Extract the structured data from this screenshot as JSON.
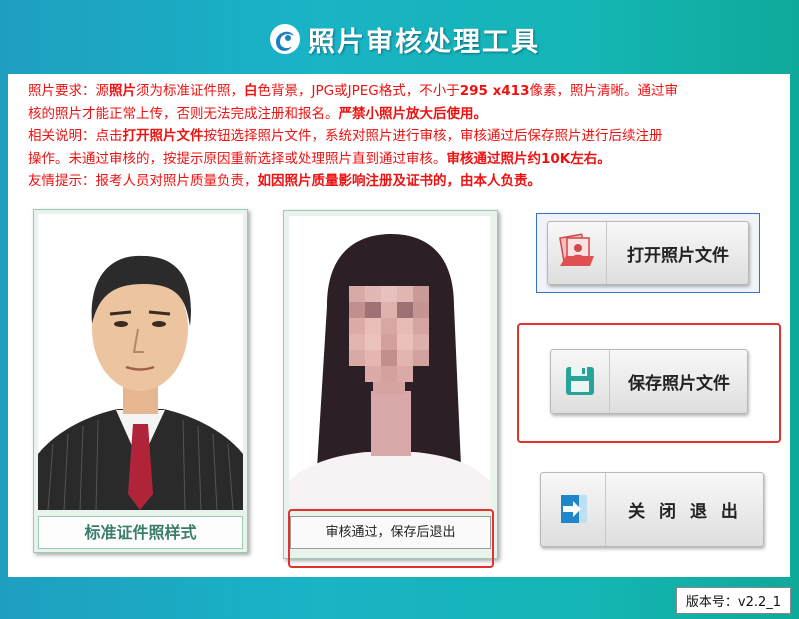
{
  "app": {
    "title": "照片审核处理工具",
    "logo_icon": "app-logo-icon"
  },
  "notice": {
    "line1": {
      "label": "照片要求：",
      "t1": "源",
      "t2": "照片",
      "t3": "须为标准证件照，",
      "t4": "白",
      "t5": "色背景，JPG或JPEG格式，不小于",
      "t6": "295 x413",
      "t7": "像素，照片清晰。通过审"
    },
    "line2": {
      "t1": "核的照片才能正常上传，否则无法完成注册和报名。",
      "t2": "严禁小照片放大后使用。"
    },
    "line3": {
      "label": "相关说明：",
      "t1": "点击",
      "t2": "打开照片文件",
      "t3": "按钮选择照片文件，系统对照片进行审核，审核通过后保存照片进行后续注册"
    },
    "line4": {
      "t1": "操作。未通过审核的，按提示原因重新选择或处理照片直到通过审核。",
      "t2": "审核通过照片约10K左右。"
    },
    "line5": {
      "label": "友情提示：",
      "t1": "报考人员对照片质量负责，",
      "t2": "如因照片质量影响注册及证书的，由本人负责。"
    }
  },
  "sample": {
    "caption": "标准证件照样式"
  },
  "uploaded": {
    "status": "审核通过，保存后退出"
  },
  "buttons": {
    "open": {
      "label": "打开照片文件",
      "icon": "open-photo-icon"
    },
    "save": {
      "label": "保存照片文件",
      "icon": "save-disk-icon"
    },
    "close": {
      "label": "关 闭 退 出",
      "icon": "exit-arrow-icon"
    }
  },
  "version": {
    "text": "版本号：v2.2_1"
  },
  "colors": {
    "accent_red": "#f01010",
    "accent_blue": "#1a3cc8",
    "caption_green": "#3b7d6c",
    "outline_red": "#e53030"
  }
}
